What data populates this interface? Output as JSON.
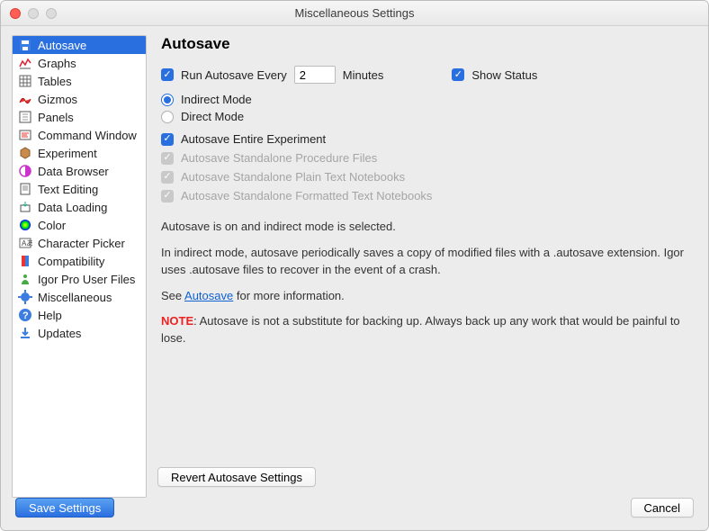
{
  "window": {
    "title": "Miscellaneous Settings"
  },
  "sidebar": {
    "items": [
      {
        "label": "Autosave"
      },
      {
        "label": "Graphs"
      },
      {
        "label": "Tables"
      },
      {
        "label": "Gizmos"
      },
      {
        "label": "Panels"
      },
      {
        "label": "Command Window"
      },
      {
        "label": "Experiment"
      },
      {
        "label": "Data Browser"
      },
      {
        "label": "Text Editing"
      },
      {
        "label": "Data Loading"
      },
      {
        "label": "Color"
      },
      {
        "label": "Character Picker"
      },
      {
        "label": "Compatibility"
      },
      {
        "label": "Igor Pro User Files"
      },
      {
        "label": "Miscellaneous"
      },
      {
        "label": "Help"
      },
      {
        "label": "Updates"
      }
    ],
    "selected_index": 0
  },
  "page": {
    "title": "Autosave",
    "run_every_label": "Run Autosave Every",
    "interval_value": "2",
    "minutes_label": "Minutes",
    "show_status_label": "Show Status",
    "indirect_label": "Indirect Mode",
    "direct_label": "Direct Mode",
    "entire_label": "Autosave Entire Experiment",
    "proc_label": "Autosave Standalone Procedure Files",
    "plain_nb_label": "Autosave Standalone Plain Text Notebooks",
    "fmt_nb_label": "Autosave Standalone Formatted Text Notebooks",
    "desc1": "Autosave is on and indirect mode is selected.",
    "desc2": "In indirect mode, autosave periodically saves a copy of modified files with a .autosave extension. Igor uses .autosave files to recover in the event of a crash.",
    "desc3_prefix": "See ",
    "desc3_link": "Autosave",
    "desc3_suffix": " for more information.",
    "note_label": "NOTE",
    "note_text": ": Autosave is not a substitute for backing up. Always back up any work that would be painful to lose.",
    "revert_label": "Revert Autosave Settings"
  },
  "footer": {
    "save_label": "Save Settings",
    "cancel_label": "Cancel"
  }
}
